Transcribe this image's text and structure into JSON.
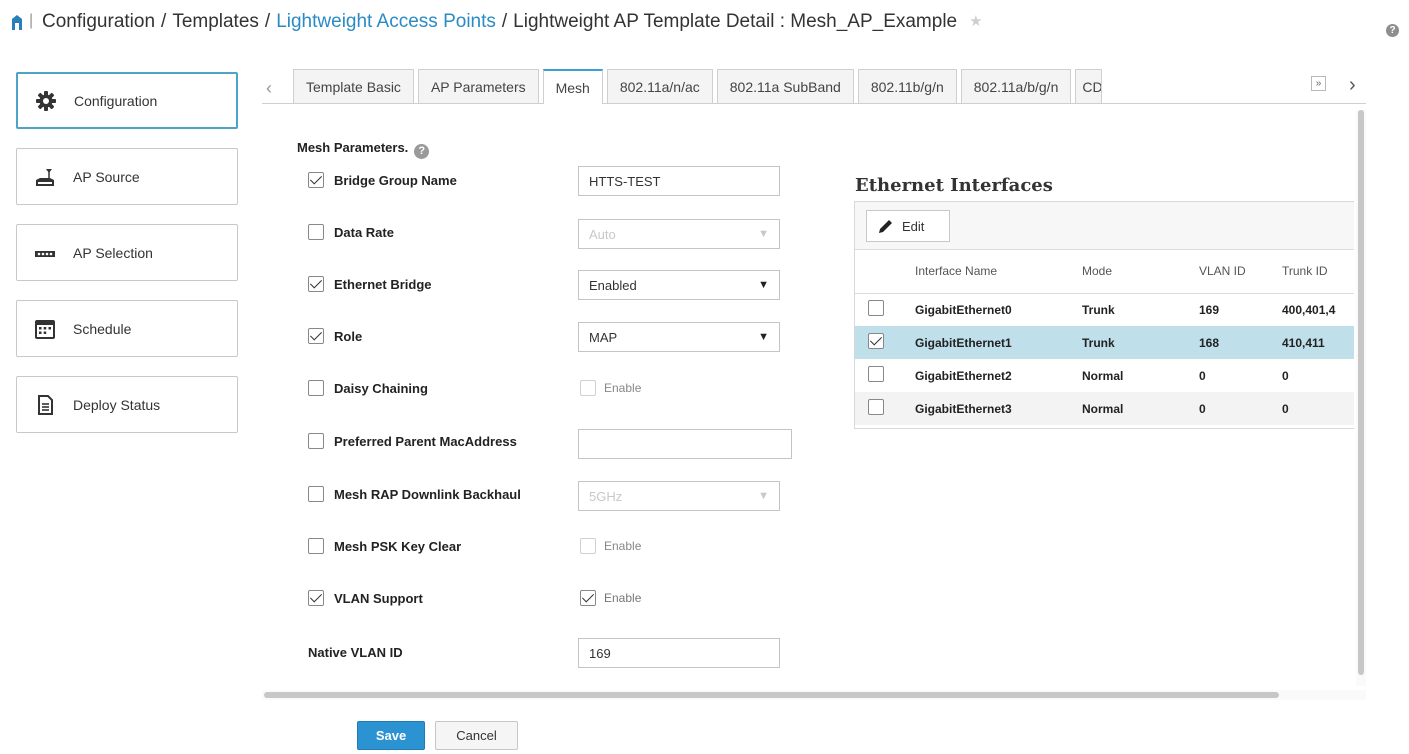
{
  "breadcrumb": {
    "parts": [
      "Configuration",
      "Templates",
      "Lightweight Access Points",
      "Lightweight AP Template Detail : Mesh_AP_Example"
    ]
  },
  "help_glyph": "?",
  "nav": {
    "items": [
      {
        "label": "Configuration",
        "icon": "gear-icon"
      },
      {
        "label": "AP Source",
        "icon": "access-point-icon"
      },
      {
        "label": "AP Selection",
        "icon": "ap-device-icon"
      },
      {
        "label": "Schedule",
        "icon": "calendar-icon"
      },
      {
        "label": "Deploy Status",
        "icon": "document-icon"
      }
    ]
  },
  "tabs": {
    "items": [
      "Template Basic",
      "AP Parameters",
      "Mesh",
      "802.11a/n/ac",
      "802.11a SubBand",
      "802.11b/g/n",
      "802.11a/b/g/n",
      "CD"
    ],
    "active": "Mesh",
    "more_glyph": "»",
    "prev_glyph": "‹",
    "next_glyph": "›"
  },
  "mesh": {
    "title": "Mesh Parameters.",
    "bridge_group_name": {
      "label": "Bridge Group Name",
      "checked": true,
      "value": "HTTS-TEST"
    },
    "data_rate": {
      "label": "Data Rate",
      "checked": false,
      "value": "Auto"
    },
    "ethernet_bridge": {
      "label": "Ethernet Bridge",
      "checked": true,
      "value": "Enabled"
    },
    "role": {
      "label": "Role",
      "checked": true,
      "value": "MAP"
    },
    "daisy_chaining": {
      "label": "Daisy Chaining",
      "checked": false,
      "option": "Enable"
    },
    "preferred_parent": {
      "label": "Preferred Parent MacAddress",
      "checked": false,
      "value": ""
    },
    "rap_downlink": {
      "label": "Mesh RAP Downlink Backhaul",
      "checked": false,
      "value": "5GHz"
    },
    "psk_key_clear": {
      "label": "Mesh PSK Key Clear",
      "checked": false,
      "option": "Enable"
    },
    "vlan_support": {
      "label": "VLAN Support",
      "checked": true,
      "option": "Enable"
    },
    "native_vlan": {
      "label": "Native VLAN ID",
      "value": "169"
    }
  },
  "ethernet": {
    "title": "Ethernet Interfaces",
    "edit_label": "Edit",
    "columns": [
      "Interface Name",
      "Mode",
      "VLAN ID",
      "Trunk ID"
    ],
    "rows": [
      {
        "name": "GigabitEthernet0",
        "mode": "Trunk",
        "vlan": "169",
        "trunk": "400,401,4",
        "selected": false
      },
      {
        "name": "GigabitEthernet1",
        "mode": "Trunk",
        "vlan": "168",
        "trunk": "410,411",
        "selected": true
      },
      {
        "name": "GigabitEthernet2",
        "mode": "Normal",
        "vlan": "0",
        "trunk": "0",
        "selected": false
      },
      {
        "name": "GigabitEthernet3",
        "mode": "Normal",
        "vlan": "0",
        "trunk": "0",
        "selected": false
      }
    ]
  },
  "buttons": {
    "save": "Save",
    "cancel": "Cancel"
  },
  "colors": {
    "link": "#2a8bc4",
    "active_tab": "#3ca0d4",
    "save_button": "#2b93d1",
    "selected_row": "#bfe0ea"
  }
}
